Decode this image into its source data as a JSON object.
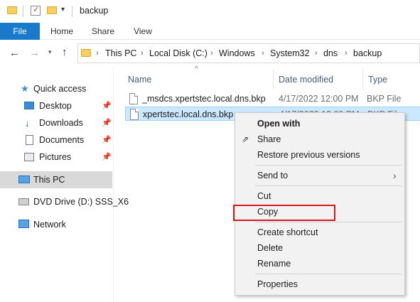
{
  "window": {
    "title": "backup"
  },
  "ribbon": {
    "tabs": [
      "File",
      "Home",
      "Share",
      "View"
    ]
  },
  "address": {
    "crumbs": [
      "This PC",
      "Local Disk (C:)",
      "Windows",
      "System32",
      "dns",
      "backup"
    ]
  },
  "nav": {
    "quick_access": "Quick access",
    "items": [
      {
        "label": "Desktop",
        "icon": "desktop-icon",
        "pinned": true
      },
      {
        "label": "Downloads",
        "icon": "download-arrow-icon",
        "pinned": true
      },
      {
        "label": "Documents",
        "icon": "documents-icon",
        "pinned": true
      },
      {
        "label": "Pictures",
        "icon": "pictures-icon",
        "pinned": true
      }
    ],
    "this_pc": "This PC",
    "dvd": "DVD Drive (D:) SSS_X6",
    "network": "Network"
  },
  "columns": {
    "name": "Name",
    "date": "Date modified",
    "type": "Type"
  },
  "files": [
    {
      "name": "_msdcs.xpertstec.local.dns.bkp",
      "date": "4/17/2022 12:00 PM",
      "type": "BKP File",
      "selected": false
    },
    {
      "name": "xpertstec.local.dns.bkp",
      "date": "4/17/2022 12:00 PM",
      "type": "BKP File",
      "selected": true
    }
  ],
  "context_menu": {
    "open_with": "Open with",
    "share": "Share",
    "restore": "Restore previous versions",
    "send_to": "Send to",
    "cut": "Cut",
    "copy": "Copy",
    "create_shortcut": "Create shortcut",
    "delete": "Delete",
    "rename": "Rename",
    "properties": "Properties"
  },
  "colors": {
    "accent": "#1979ca",
    "selection": "#cce8ff",
    "highlight_box": "#d21c1c"
  }
}
